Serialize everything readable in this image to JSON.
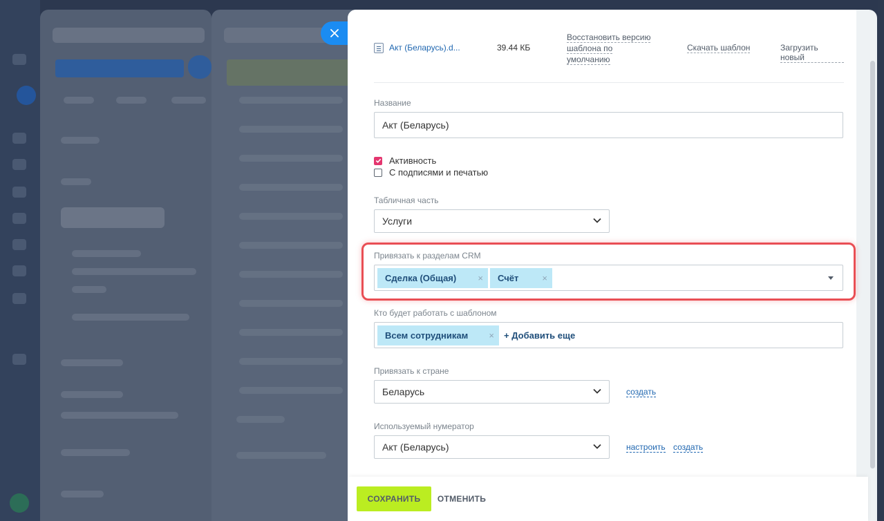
{
  "file": {
    "name": "Акт (Беларусь).d...",
    "size": "39.44 КБ",
    "restore_link": "Восстановить версию шаблона по умолчанию",
    "download_link": "Скачать шаблон",
    "upload_link": "Загрузить новый"
  },
  "name_field": {
    "label": "Название",
    "value": "Акт (Беларусь)"
  },
  "checkboxes": [
    {
      "label": "Активность",
      "checked": true
    },
    {
      "label": "С подписями и печатью",
      "checked": false
    }
  ],
  "table_part": {
    "label": "Табличная часть",
    "value": "Услуги"
  },
  "crm_sections": {
    "label": "Привязать к разделам CRM",
    "tags": [
      "Сделка (Общая)",
      "Счёт"
    ]
  },
  "who_works": {
    "label": "Кто будет работать с шаблоном",
    "tags": [
      "Всем сотрудникам"
    ],
    "add_more": "+ Добавить еще"
  },
  "country": {
    "label": "Привязать к стране",
    "value": "Беларусь",
    "create_link": "создать"
  },
  "numerator": {
    "label": "Используемый нумератор",
    "value": "Акт (Беларусь)",
    "configure_link": "настроить",
    "create_link": "создать"
  },
  "footer": {
    "save_label": "СОХРАНИТЬ",
    "cancel_label": "ОТМЕНИТЬ"
  },
  "colors": {
    "accent_save": "#bbed21",
    "highlight": "#e94e54",
    "tag_bg": "#bde8f7",
    "checkbox_on": "#e4366f",
    "link": "#2067b0"
  }
}
